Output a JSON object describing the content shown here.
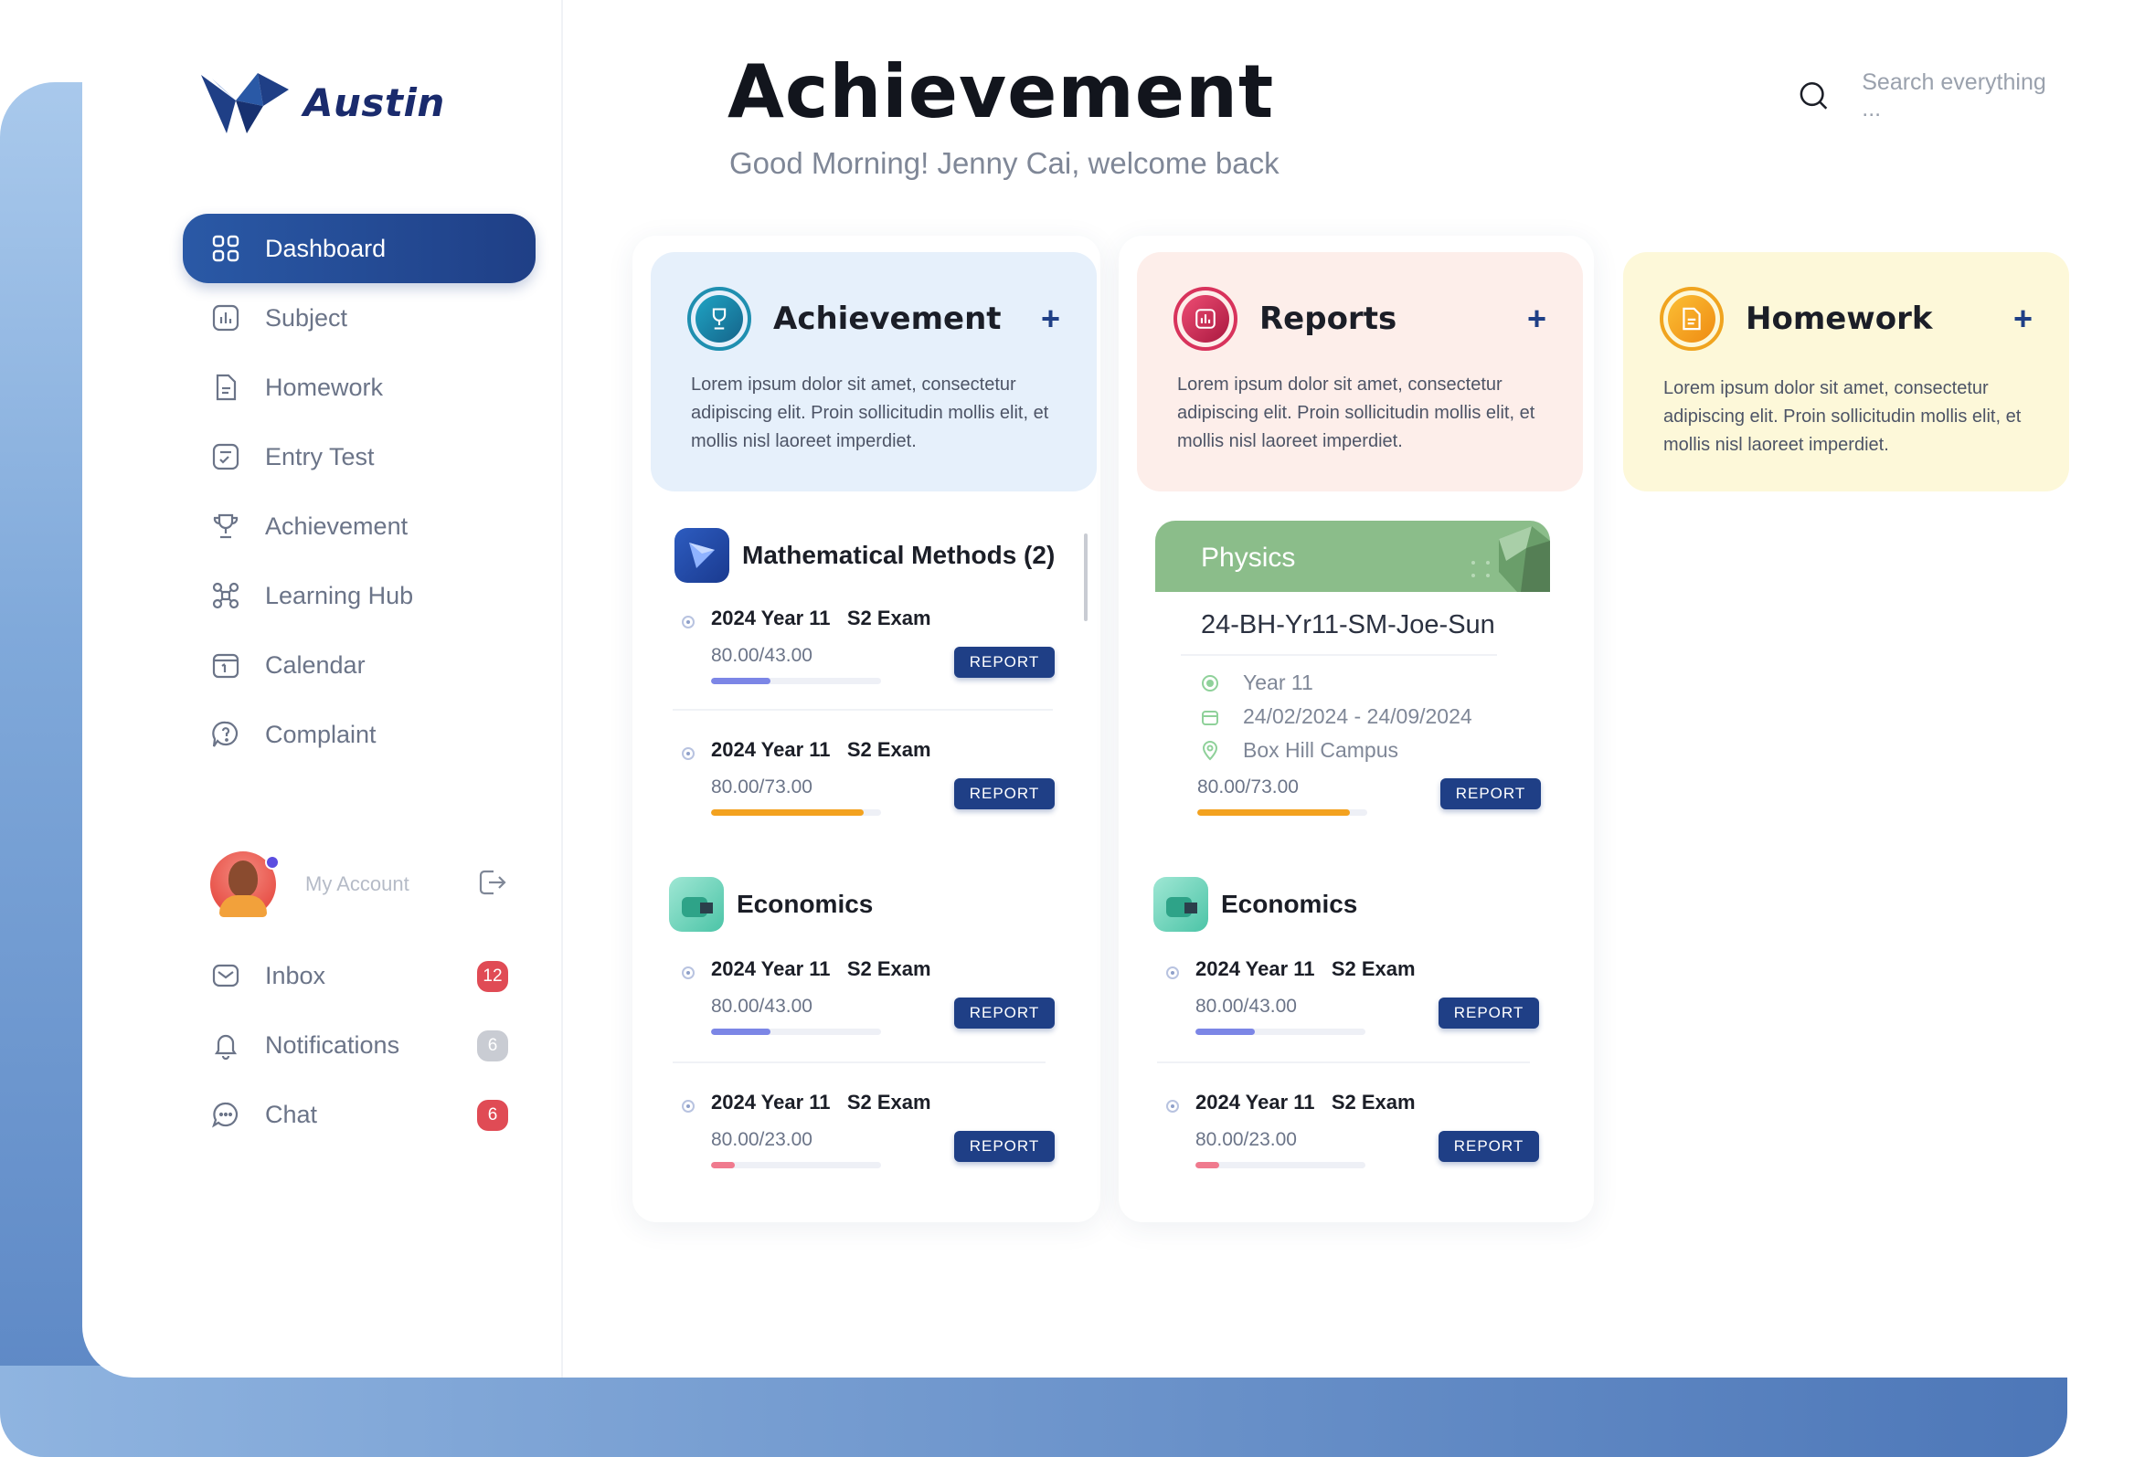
{
  "app": {
    "brand": "Austin"
  },
  "sidebar": {
    "items": [
      {
        "label": "Dashboard",
        "icon": "dashboard-grid-icon",
        "active": true
      },
      {
        "label": "Subject",
        "icon": "bar-chart-icon"
      },
      {
        "label": "Homework",
        "icon": "document-icon"
      },
      {
        "label": "Entry Test",
        "icon": "checklist-icon"
      },
      {
        "label": "Achievement",
        "icon": "trophy-icon"
      },
      {
        "label": "Learning Hub",
        "icon": "network-icon"
      },
      {
        "label": "Calendar",
        "icon": "calendar-icon"
      },
      {
        "label": "Complaint",
        "icon": "speech-question-icon"
      }
    ],
    "account": {
      "label": "My Account"
    },
    "bottom_items": [
      {
        "label": "Inbox",
        "icon": "mail-icon",
        "badge": "12"
      },
      {
        "label": "Notifications",
        "icon": "bell-icon",
        "badge": "6"
      },
      {
        "label": "Chat",
        "icon": "chat-icon",
        "badge": "6"
      }
    ]
  },
  "header": {
    "title": "Achievement",
    "greeting": "Good Morning! Jenny Cai,  welcome back",
    "search_placeholder": "Search everything ..."
  },
  "cards": [
    {
      "title": "Achievement",
      "plus": "+",
      "desc": "Lorem ipsum dolor sit amet, consectetur adipiscing elit. Proin sollicitudin mollis elit, et mollis nisl laoreet imperdiet.",
      "bg": "#e6f0fb",
      "accent": "#1f8fb0"
    },
    {
      "title": "Reports",
      "plus": "+",
      "desc": "Lorem ipsum dolor sit amet, consectetur adipiscing elit. Proin sollicitudin mollis elit, et mollis nisl laoreet imperdiet.",
      "bg": "#fdeeea",
      "accent": "#d8335c"
    },
    {
      "title": "Homework",
      "plus": "+",
      "desc": "Lorem ipsum dolor sit amet, consectetur adipiscing elit. Proin sollicitudin mollis elit, et mollis nisl laoreet imperdiet.",
      "bg": "#fdf8d9",
      "accent": "#f0a41f"
    }
  ],
  "col1": {
    "math": {
      "title": "Mathematical Methods (2)",
      "exams": [
        {
          "name": "2024 Year 11   S2 Exam",
          "score": "80.00/43.00",
          "progress": 0.35,
          "color": "#7c86e6",
          "button": "REPORT"
        },
        {
          "name": "2024 Year 11   S2 Exam",
          "score": "80.00/73.00",
          "progress": 0.9,
          "color": "#f3a21f",
          "button": "REPORT"
        }
      ]
    },
    "econ": {
      "title": "Economics",
      "exams": [
        {
          "name": "2024 Year 11   S2 Exam",
          "score": "80.00/43.00",
          "progress": 0.35,
          "color": "#7c86e6",
          "button": "REPORT"
        },
        {
          "name": "2024 Year 11   S2 Exam",
          "score": "80.00/23.00",
          "progress": 0.14,
          "color": "#f07a8e",
          "button": "REPORT"
        }
      ]
    }
  },
  "col2": {
    "physics": {
      "title": "Physics",
      "code": "24-BH-Yr11-SM-Joe-Sun",
      "year": "Year 11",
      "dates": "24/02/2024 - 24/09/2024",
      "campus": "Box Hill Campus",
      "score": "80.00/73.00",
      "progress": 0.9,
      "color": "#f3a21f",
      "button": "REPORT"
    },
    "econ": {
      "title": "Economics",
      "exams": [
        {
          "name": "2024 Year 11   S2 Exam",
          "score": "80.00/43.00",
          "progress": 0.35,
          "color": "#7c86e6",
          "button": "REPORT"
        },
        {
          "name": "2024 Year 11   S2 Exam",
          "score": "80.00/23.00",
          "progress": 0.14,
          "color": "#f07a8e",
          "button": "REPORT"
        }
      ]
    }
  }
}
